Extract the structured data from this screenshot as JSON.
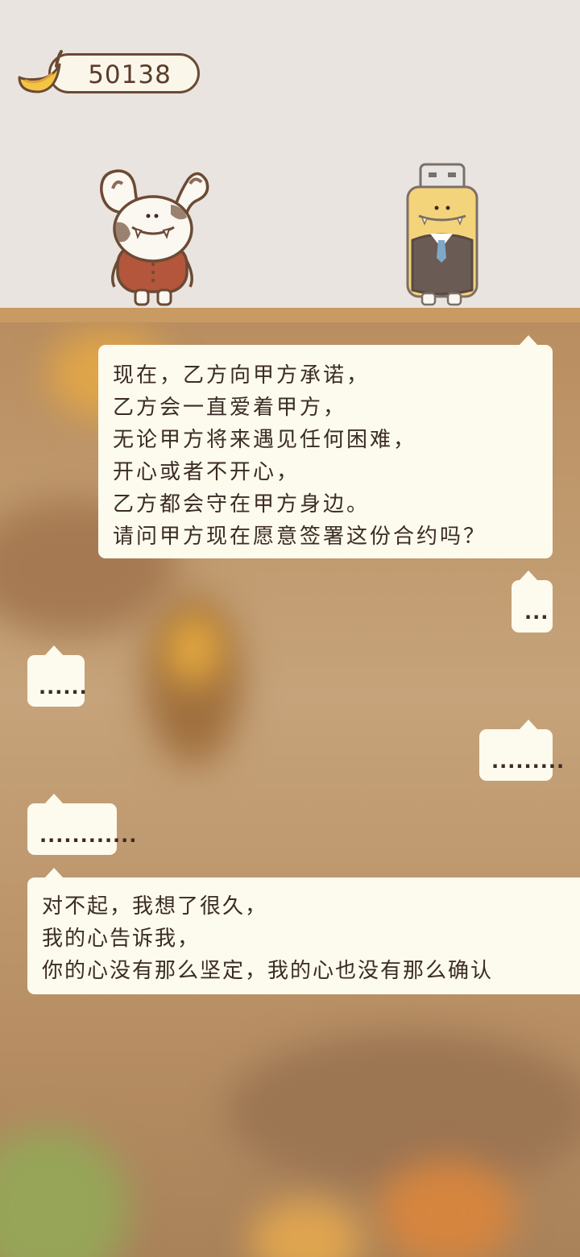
{
  "hud": {
    "coin_count": "50138",
    "coin_icon": "banana-icon"
  },
  "characters": [
    {
      "name": "bunny-character",
      "role": "left"
    },
    {
      "name": "robot-suit-character",
      "role": "right"
    }
  ],
  "dialogue": [
    {
      "speaker": "right",
      "text": "现在，乙方向甲方承诺，\n乙方会一直爱着甲方，\n无论甲方将来遇见任何困难，\n开心或者不开心，\n乙方都会守在甲方身边。\n请问甲方现在愿意签署这份合约吗？"
    },
    {
      "speaker": "right",
      "text": "..."
    },
    {
      "speaker": "left",
      "text": "......"
    },
    {
      "speaker": "right",
      "text": "........."
    },
    {
      "speaker": "left",
      "text": "............"
    },
    {
      "speaker": "left",
      "text": "对不起，我想了很久，\n我的心告诉我，\n你的心没有那么坚定，我的心也没有那么确认"
    }
  ],
  "colors": {
    "shelf": "#c99a62",
    "bubble": "#fdfaee",
    "top_background": "#e9e4df",
    "outline": "#6b4a34"
  }
}
